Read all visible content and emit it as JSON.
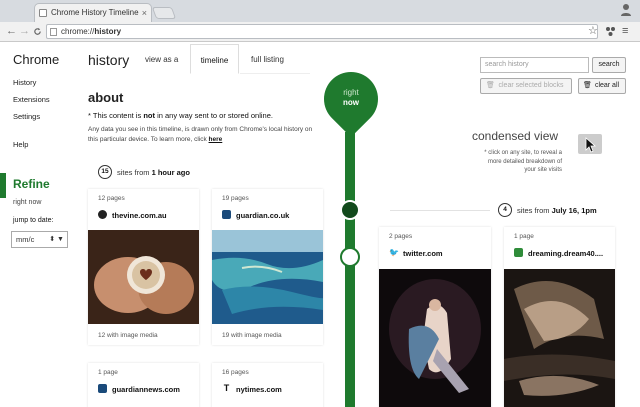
{
  "browser": {
    "tab_title": "Chrome History Timeline",
    "tab_close": "×",
    "back": "←",
    "forward": "→",
    "reload": "C",
    "url_prefix": "chrome://",
    "url_path": "history",
    "star": "☆",
    "menu": "≡"
  },
  "sidebar": {
    "brand": "Chrome",
    "items": [
      {
        "label": "History"
      },
      {
        "label": "Extensions"
      },
      {
        "label": "Settings"
      },
      {
        "label": "Help"
      }
    ],
    "refine_title": "Refine",
    "right_now": "right now",
    "jump_label": "jump to date:",
    "date_value": "mm/c",
    "date_arrow": "⬍ ▼"
  },
  "header": {
    "title": "history",
    "tabs": [
      {
        "label": "view as a"
      },
      {
        "label": "timeline"
      },
      {
        "label": "full listing"
      }
    ]
  },
  "about": {
    "title": "about",
    "line1_pre": "* This content is ",
    "line1_bold": "not",
    "line1_post": " in any way sent to or stored online.",
    "line2": "Any data you see in this timeline, is drawn only from Chrome's local history on this particular device. To learn more, click ",
    "line2_link": "here"
  },
  "toolbar": {
    "search_placeholder": "search history",
    "search_button": "search",
    "clear_selected": "clear selected blocks",
    "clear_all": "clear all"
  },
  "timeline": {
    "now_line1": "right",
    "now_line2": "now"
  },
  "condensed": {
    "title": "condensed view",
    "text": "* click on any site, to reveal a more detailed breakdown of your site visits"
  },
  "group1": {
    "count": "15",
    "label": "sites from ",
    "when": "1 hour ago",
    "cards": [
      {
        "pages": "12 pages",
        "site": "thevine.com.au",
        "media": "12 with image media"
      },
      {
        "pages": "19 pages",
        "site": "guardian.co.uk",
        "media": "19 with image media"
      },
      {
        "pages": "1 page",
        "site": "guardiannews.com"
      },
      {
        "pages": "16 pages",
        "site": "nytimes.com"
      }
    ]
  },
  "group2": {
    "count": "4",
    "label": "sites from ",
    "when": "July 16, 1pm",
    "cards": [
      {
        "pages": "2 pages",
        "site": "twitter.com"
      },
      {
        "pages": "1 page",
        "site": "dreaming.dream40...."
      }
    ]
  },
  "colors": {
    "accent": "#1f7a2e",
    "dark_node": "#124a1c"
  }
}
